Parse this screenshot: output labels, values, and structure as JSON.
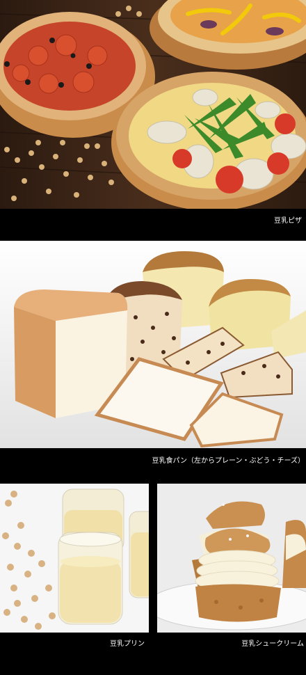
{
  "captions": {
    "pizza": "豆乳ピザ",
    "bread": "豆乳食パン（左からプレーン・ぶどう・チーズ）",
    "pudding": "豆乳プリン",
    "cream_puff": "豆乳シュークリーム"
  },
  "colors": {
    "background": "#000000",
    "caption_text": "#ffffff",
    "wood_table": "#3a2417",
    "bread_backdrop": "#ececec",
    "pudding_backdrop": "#f6f6f6"
  }
}
